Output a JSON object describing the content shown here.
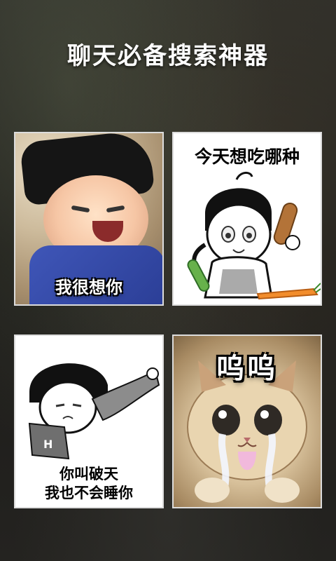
{
  "header": {
    "title": "聊天必备搜索神器"
  },
  "stickers": [
    {
      "caption": "我很想你"
    },
    {
      "caption": "今天想吃哪种"
    },
    {
      "caption_lines": [
        "你叫破天",
        "我也不会睡你"
      ]
    },
    {
      "caption": "呜呜"
    }
  ],
  "colors": {
    "title": "#ffffff",
    "robe_blue": "#3f56b8",
    "card_border": "#dcdcdc"
  }
}
